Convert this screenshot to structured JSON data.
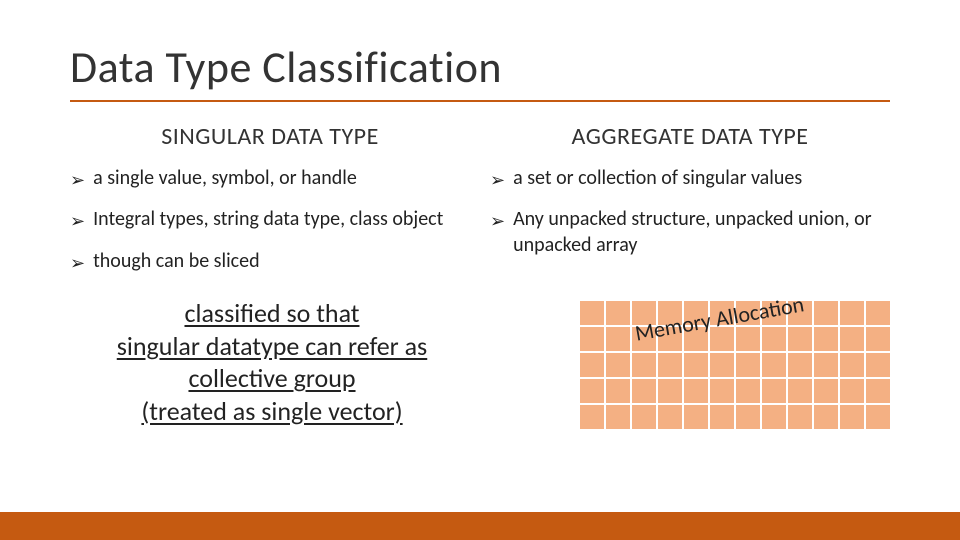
{
  "title": "Data Type Classification",
  "columns": {
    "left": {
      "heading": "SINGULAR DATA TYPE",
      "bullets": [
        "a single value, symbol, or handle",
        "Integral types, string data type, class object",
        "though can be sliced"
      ]
    },
    "right": {
      "heading": "AGGREGATE DATA TYPE",
      "bullets": [
        "a set or collection of singular values",
        "Any unpacked structure, unpacked union, or unpacked array"
      ]
    }
  },
  "summary_lines": [
    "classified so that",
    "singular datatype can refer as",
    "collective group",
    "(treated as single vector)"
  ],
  "memory_label": "Memory Allocation",
  "bullet_glyph": "➢",
  "grid": {
    "rows": 5,
    "cols": 12
  }
}
